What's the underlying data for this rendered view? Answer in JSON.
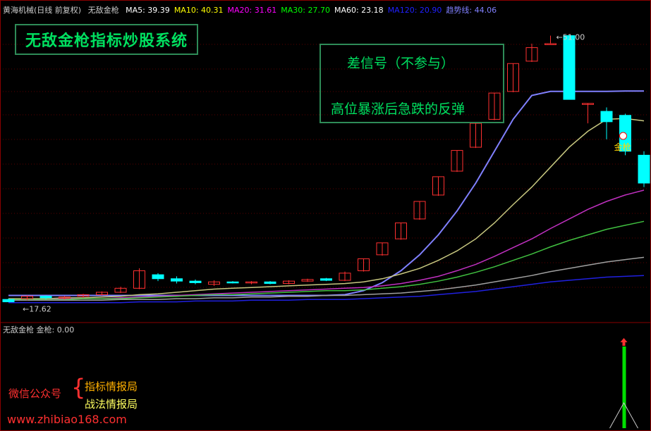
{
  "header": {
    "stock": "黄海机械(日线 前复权)",
    "indicator": "无敌金枪",
    "ma": [
      {
        "label": "MA5: 39.39",
        "color": "#ffffff"
      },
      {
        "label": "MA10: 40.31",
        "color": "#ffff00"
      },
      {
        "label": "MA20: 31.61",
        "color": "#ff00ff"
      },
      {
        "label": "MA30: 27.70",
        "color": "#00ff00"
      },
      {
        "label": "MA60: 23.18",
        "color": "#ffffff"
      },
      {
        "label": "MA120: 20.90",
        "color": "#2020ff"
      },
      {
        "label": "趋势线: 44.06",
        "color": "#8080ff"
      }
    ]
  },
  "banner": {
    "title": "无敌金枪指标炒股系统"
  },
  "note": {
    "line1": "差信号（不参与）",
    "line2": "高位暴涨后急跌的反弹"
  },
  "price_labels": {
    "high": "51.00",
    "low": "17.62",
    "signal": "金枪"
  },
  "sub_panel": {
    "title": "无敌金枪 金枪: 0.00"
  },
  "watermark": {
    "label": "微信公众号",
    "account1": "指标情报局",
    "account2": "战法情报局",
    "url": "www.zhibiao168.com"
  },
  "colors": {
    "bg": "#000000",
    "border": "#8a0000",
    "up": "#ff3030",
    "down": "#00ffff",
    "trend": "#8080ff"
  },
  "chart_data": {
    "type": "candlestick",
    "candles": [
      {
        "o": 17.9,
        "c": 17.6,
        "h": 18.0,
        "l": 17.62
      },
      {
        "o": 18.0,
        "c": 18.3,
        "h": 18.4,
        "l": 17.8
      },
      {
        "o": 18.3,
        "c": 18.1,
        "h": 18.4,
        "l": 17.9
      },
      {
        "o": 18.1,
        "c": 18.2,
        "h": 18.3,
        "l": 17.9
      },
      {
        "o": 18.3,
        "c": 18.5,
        "h": 18.6,
        "l": 18.1
      },
      {
        "o": 18.5,
        "c": 18.8,
        "h": 18.9,
        "l": 18.4
      },
      {
        "o": 18.8,
        "c": 19.3,
        "h": 19.5,
        "l": 18.7
      },
      {
        "o": 19.3,
        "c": 21.5,
        "h": 21.8,
        "l": 19.2
      },
      {
        "o": 21.0,
        "c": 20.5,
        "h": 21.2,
        "l": 20.2
      },
      {
        "o": 20.5,
        "c": 20.2,
        "h": 20.8,
        "l": 19.9
      },
      {
        "o": 20.2,
        "c": 20.0,
        "h": 20.4,
        "l": 19.8
      },
      {
        "o": 19.8,
        "c": 20.1,
        "h": 20.3,
        "l": 19.6
      },
      {
        "o": 20.1,
        "c": 20.0,
        "h": 20.2,
        "l": 19.9
      },
      {
        "o": 20.0,
        "c": 20.1,
        "h": 20.2,
        "l": 19.8
      },
      {
        "o": 20.1,
        "c": 19.9,
        "h": 20.2,
        "l": 19.8
      },
      {
        "o": 19.9,
        "c": 20.2,
        "h": 20.3,
        "l": 19.8
      },
      {
        "o": 20.2,
        "c": 20.4,
        "h": 20.5,
        "l": 20.1
      },
      {
        "o": 20.5,
        "c": 20.3,
        "h": 20.6,
        "l": 20.2
      },
      {
        "o": 20.3,
        "c": 21.2,
        "h": 21.4,
        "l": 20.2
      },
      {
        "o": 21.5,
        "c": 23.0,
        "h": 23.0,
        "l": 21.4
      },
      {
        "o": 23.5,
        "c": 25.0,
        "h": 25.0,
        "l": 23.4
      },
      {
        "o": 25.5,
        "c": 27.5,
        "h": 27.5,
        "l": 25.4
      },
      {
        "o": 28.0,
        "c": 30.2,
        "h": 30.2,
        "l": 27.9
      },
      {
        "o": 31.0,
        "c": 33.3,
        "h": 33.3,
        "l": 30.9
      },
      {
        "o": 34.0,
        "c": 36.6,
        "h": 36.6,
        "l": 33.9
      },
      {
        "o": 37.0,
        "c": 40.0,
        "h": 40.0,
        "l": 36.9
      },
      {
        "o": 40.5,
        "c": 43.8,
        "h": 43.8,
        "l": 40.4
      },
      {
        "o": 44.0,
        "c": 47.5,
        "h": 47.5,
        "l": 43.9
      },
      {
        "o": 47.8,
        "c": 49.5,
        "h": 50.0,
        "l": 47.7
      },
      {
        "o": 50.0,
        "c": 50.0,
        "h": 51.0,
        "l": 50.0
      },
      {
        "o": 51.0,
        "c": 43.0,
        "h": 51.0,
        "l": 43.0
      },
      {
        "o": 42.5,
        "c": 42.5,
        "h": 42.5,
        "l": 40.0
      },
      {
        "o": 41.5,
        "c": 40.2,
        "h": 42.0,
        "l": 38.0
      },
      {
        "o": 41.0,
        "c": 36.5,
        "h": 41.2,
        "l": 36.0
      },
      {
        "o": 36.0,
        "c": 32.5,
        "h": 36.5,
        "l": 32.0
      }
    ],
    "lines": [
      {
        "name": "趋势线",
        "color": "#8080ff",
        "values": [
          18.4,
          18.4,
          18.4,
          18.4,
          18.4,
          18.4,
          18.4,
          18.4,
          18.4,
          18.4,
          18.4,
          18.4,
          18.4,
          18.4,
          18.4,
          18.4,
          18.4,
          18.4,
          18.5,
          19.0,
          20.0,
          21.5,
          23.5,
          26.0,
          29.0,
          32.5,
          36.5,
          40.5,
          43.5,
          44.0,
          44.0,
          44.0,
          44.0,
          44.06,
          44.06
        ]
      },
      {
        "name": "MA10",
        "color": "#c8c880",
        "values": [
          18.0,
          18.0,
          18.0,
          18.1,
          18.1,
          18.2,
          18.3,
          18.5,
          18.6,
          18.8,
          19.0,
          19.2,
          19.3,
          19.4,
          19.5,
          19.6,
          19.7,
          19.8,
          19.9,
          20.1,
          20.5,
          21.1,
          21.8,
          22.8,
          24.0,
          25.5,
          27.5,
          29.8,
          32.0,
          34.5,
          37.0,
          39.0,
          40.5,
          40.6,
          40.31
        ]
      },
      {
        "name": "MA20",
        "color": "#c030c0",
        "values": [
          17.9,
          17.9,
          17.9,
          18.0,
          18.0,
          18.0,
          18.1,
          18.2,
          18.3,
          18.4,
          18.5,
          18.6,
          18.7,
          18.8,
          18.9,
          19.0,
          19.1,
          19.2,
          19.3,
          19.4,
          19.6,
          19.9,
          20.3,
          20.8,
          21.5,
          22.3,
          23.3,
          24.4,
          25.5,
          26.8,
          28.0,
          29.2,
          30.2,
          31.0,
          31.61
        ]
      },
      {
        "name": "MA30",
        "color": "#40c040",
        "values": [
          17.9,
          17.9,
          17.9,
          17.9,
          18.0,
          18.0,
          18.0,
          18.1,
          18.2,
          18.3,
          18.4,
          18.5,
          18.5,
          18.6,
          18.7,
          18.8,
          18.9,
          19.0,
          19.0,
          19.1,
          19.3,
          19.5,
          19.8,
          20.2,
          20.7,
          21.3,
          22.0,
          22.8,
          23.6,
          24.5,
          25.3,
          26.0,
          26.7,
          27.2,
          27.7
        ]
      },
      {
        "name": "MA60",
        "color": "#a0a0a0",
        "values": [
          17.8,
          17.8,
          17.8,
          17.8,
          17.8,
          17.8,
          17.9,
          17.9,
          17.9,
          18.0,
          18.0,
          18.1,
          18.1,
          18.2,
          18.2,
          18.3,
          18.3,
          18.4,
          18.4,
          18.5,
          18.6,
          18.7,
          18.9,
          19.1,
          19.4,
          19.7,
          20.1,
          20.5,
          20.9,
          21.4,
          21.8,
          22.2,
          22.6,
          22.9,
          23.18
        ]
      },
      {
        "name": "MA120",
        "color": "#2020e0",
        "values": [
          17.5,
          17.5,
          17.5,
          17.5,
          17.5,
          17.5,
          17.5,
          17.6,
          17.6,
          17.6,
          17.7,
          17.7,
          17.7,
          17.8,
          17.8,
          17.8,
          17.9,
          17.9,
          17.9,
          18.0,
          18.1,
          18.2,
          18.3,
          18.5,
          18.7,
          18.9,
          19.2,
          19.5,
          19.8,
          20.1,
          20.3,
          20.5,
          20.7,
          20.8,
          20.9
        ]
      }
    ],
    "signal": {
      "index": 33,
      "value": 1
    }
  }
}
